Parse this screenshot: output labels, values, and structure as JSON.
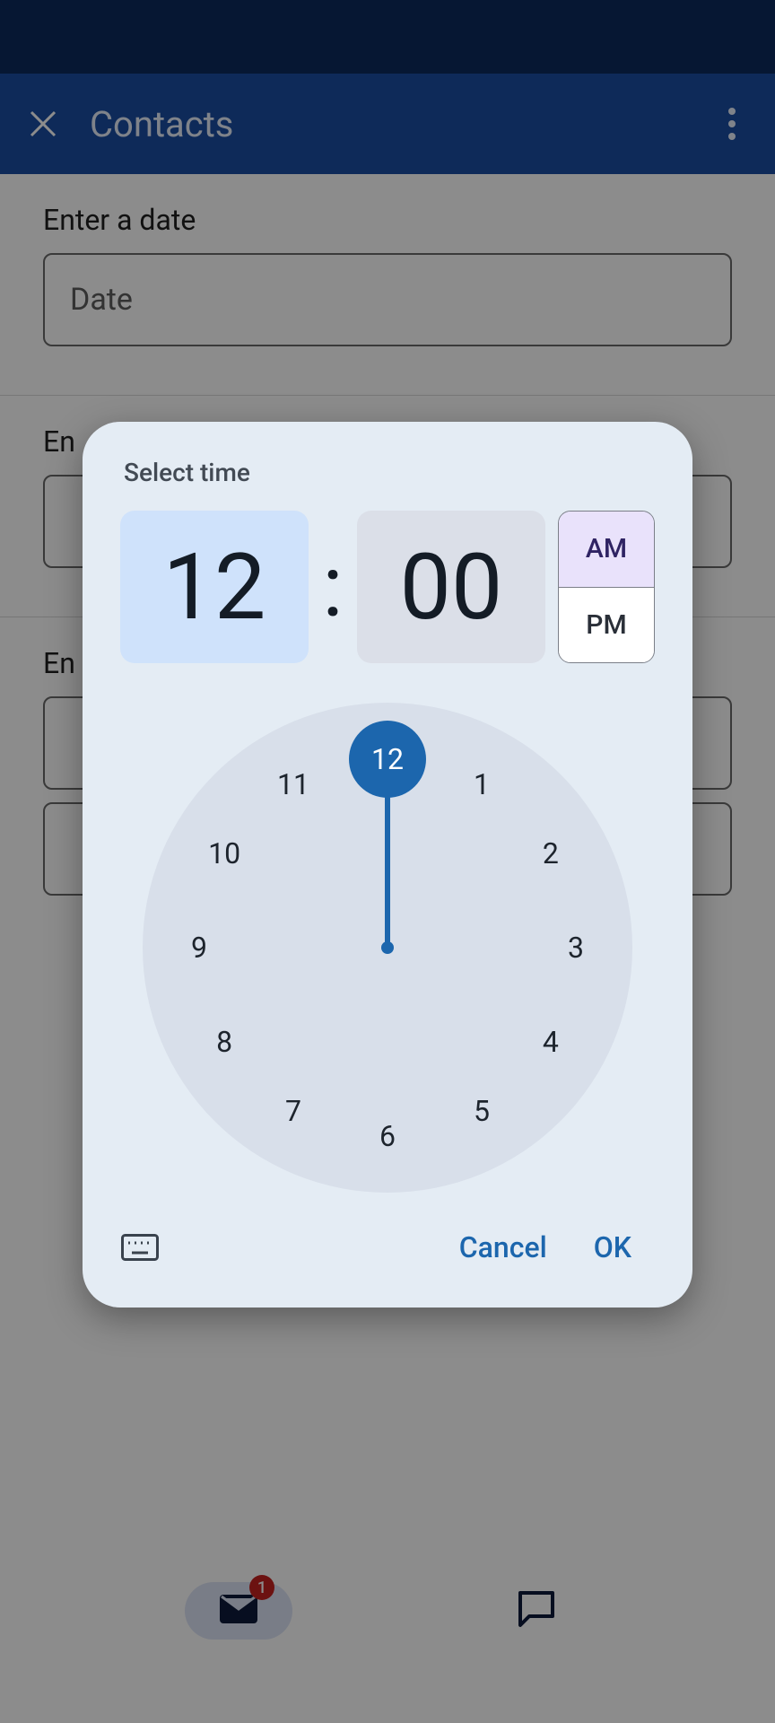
{
  "appbar": {
    "title": "Contacts"
  },
  "form": {
    "date_label": "Enter a date",
    "date_placeholder": "Date",
    "time_label_partial": "En",
    "field2_label_partial": "En"
  },
  "nav": {
    "badge": "1"
  },
  "dialog": {
    "title": "Select time",
    "hour": "12",
    "minute": "00",
    "am": "AM",
    "pm": "PM",
    "selected_period": "AM",
    "cancel": "Cancel",
    "ok": "OK",
    "clock": {
      "numbers": [
        "12",
        "1",
        "2",
        "3",
        "4",
        "5",
        "6",
        "7",
        "8",
        "9",
        "10",
        "11"
      ],
      "selected": "12"
    }
  }
}
